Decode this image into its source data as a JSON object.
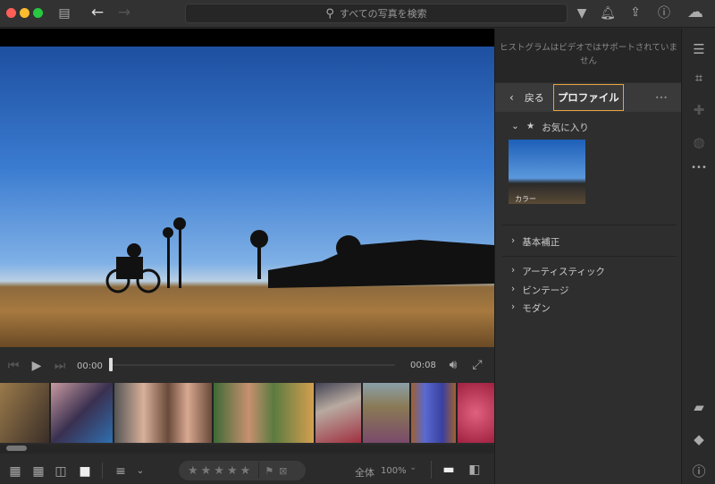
{
  "titlebar": {
    "search_placeholder": "すべての写真を検索"
  },
  "viewer": {
    "current_time": "00:00",
    "duration": "00:08",
    "progress": 0
  },
  "panel": {
    "histogram_message": "ヒストグラムはビデオではサポートされていません",
    "back_label": "戻る",
    "title": "プロファイル",
    "more": "•••",
    "favorites_label": "お気に入り",
    "favorite_thumb_label": "カラー",
    "groups": [
      "基本補正",
      "アーティスティック",
      "ビンテージ",
      "モダン"
    ]
  },
  "bottombar": {
    "zoom_fit": "全体",
    "zoom_level": "100%"
  },
  "filmstrip": {
    "thumb_colors": [
      "#6b5a3a",
      "#5a4a68",
      "#7a6a5a",
      "#5f6a45",
      "#8a7a70",
      "#7a7060",
      "#4a4a9a",
      "#c04060"
    ]
  },
  "colors": {
    "accent": "#e8a33d",
    "background": "#2b2b2b"
  }
}
